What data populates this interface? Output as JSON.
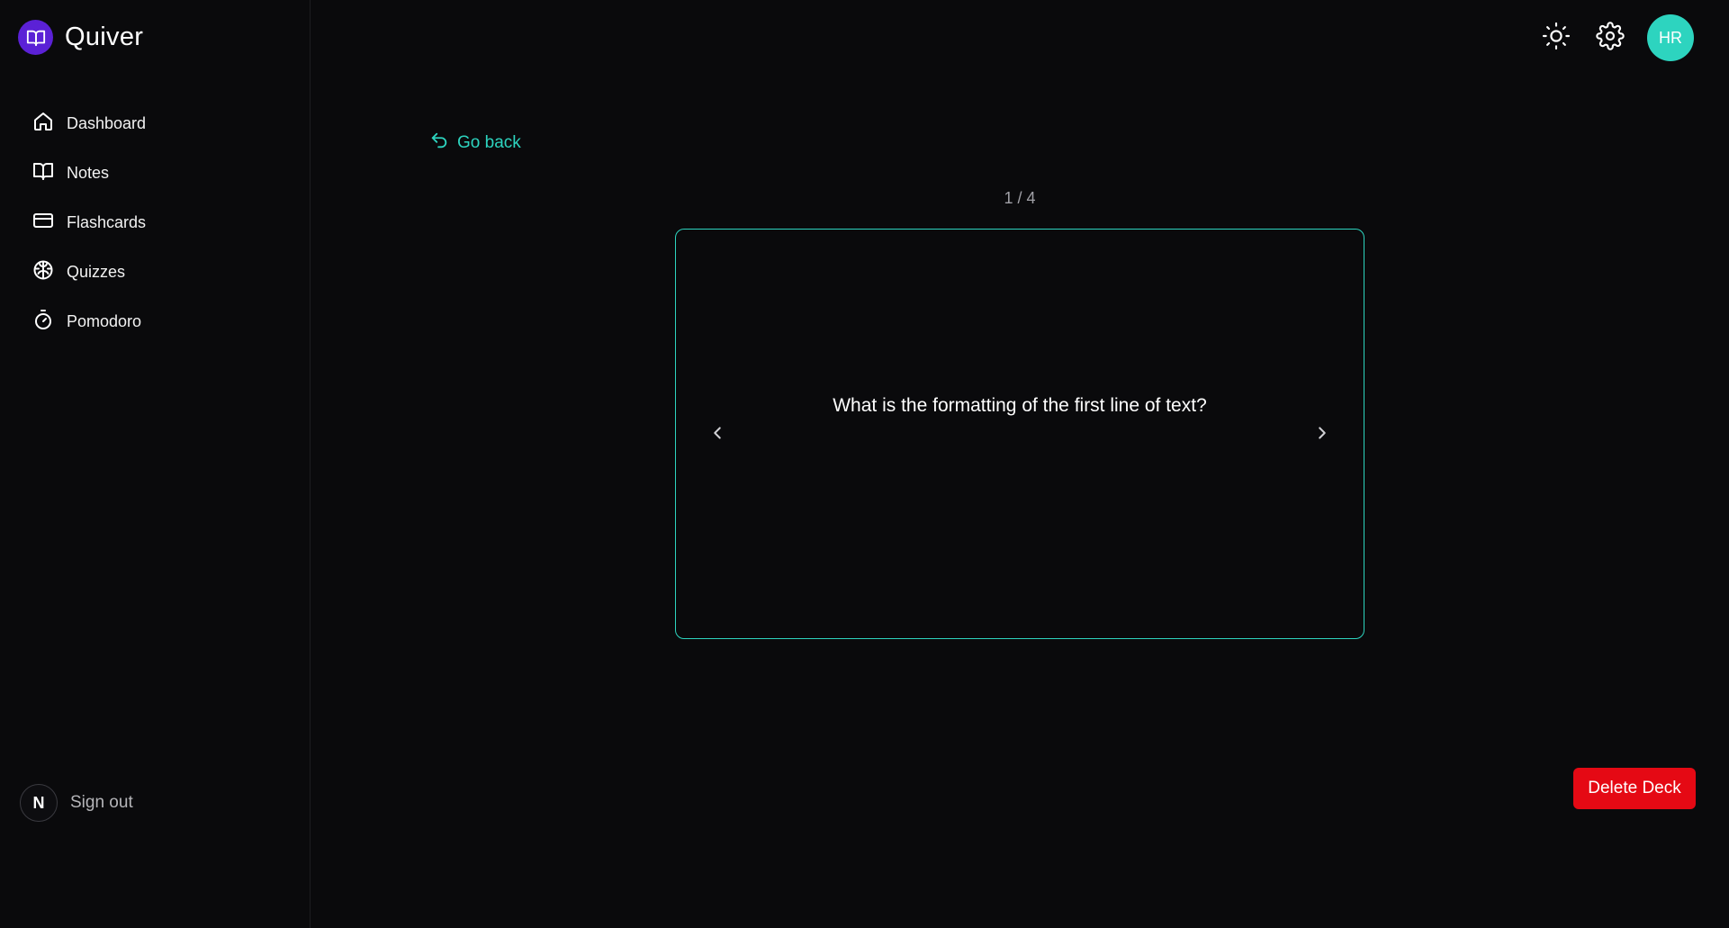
{
  "app": {
    "name": "Quiver"
  },
  "sidebar": {
    "items": [
      {
        "label": "Dashboard",
        "icon": "home-icon"
      },
      {
        "label": "Notes",
        "icon": "book-open-icon"
      },
      {
        "label": "Flashcards",
        "icon": "credit-card-icon"
      },
      {
        "label": "Quizzes",
        "icon": "brain-icon"
      },
      {
        "label": "Pomodoro",
        "icon": "timer-icon"
      }
    ],
    "signout": {
      "avatar_letter": "N",
      "label": "Sign out"
    }
  },
  "header": {
    "theme_icon": "sun-icon",
    "settings_icon": "gear-icon",
    "user_initials": "HR"
  },
  "main": {
    "go_back_label": "Go back",
    "counter": "1 / 4",
    "card": {
      "question": "What is the formatting of the first line of text?"
    },
    "delete_label": "Delete Deck"
  },
  "colors": {
    "background": "#0a0a0c",
    "accent": "#2dd4bf",
    "brand": "#5b21d6",
    "danger": "#e50914"
  }
}
